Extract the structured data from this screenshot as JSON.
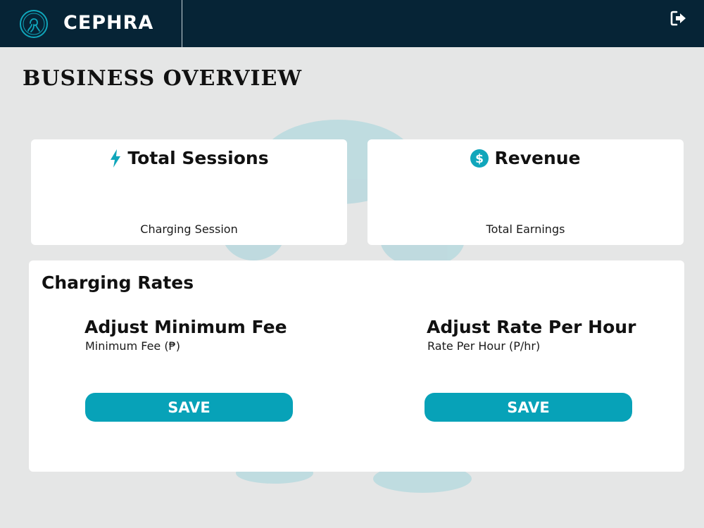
{
  "app": {
    "name": "CEPHRA"
  },
  "header": {
    "logout_icon": "logout-icon"
  },
  "page": {
    "title": "BUSINESS OVERVIEW"
  },
  "cards": {
    "sessions": {
      "icon": "bolt-icon",
      "title": "Total Sessions",
      "subtitle": "Charging Session"
    },
    "revenue": {
      "icon": "dollar-icon",
      "title": "Revenue",
      "subtitle": "Total Earnings"
    }
  },
  "rates": {
    "title": "Charging Rates",
    "minimum_fee": {
      "heading": "Adjust Minimum Fee",
      "label": "Minimum Fee (₱)",
      "save_label": "SAVE"
    },
    "rate_per_hour": {
      "heading": "Adjust Rate Per Hour",
      "label": "Rate Per Hour (P/hr)",
      "save_label": "SAVE"
    }
  },
  "colors": {
    "header_bg": "#062436",
    "accent": "#07a2b8",
    "page_bg": "#e5e6e6"
  }
}
